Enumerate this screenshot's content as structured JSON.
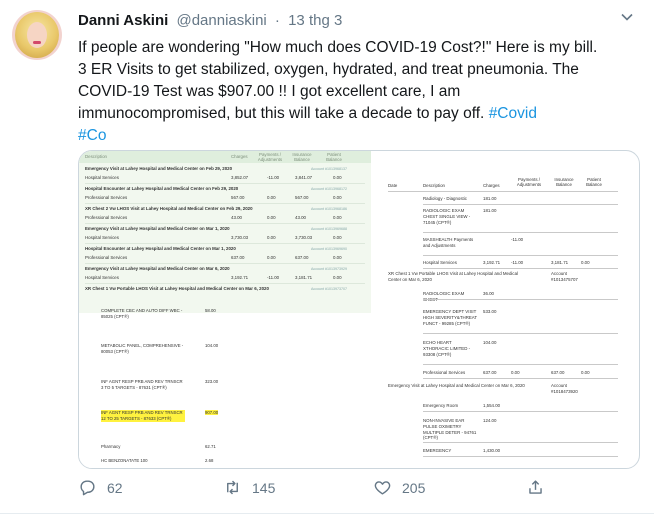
{
  "tweet": {
    "display_name": "Danni Askini",
    "handle": "@danniaskini",
    "separator": "·",
    "date": "13 thg 3",
    "text_lines": [
      "If people are wondering \"How much does COVID-19 Cost?!\" Here is my bill.",
      "3 ER Visits to get stabilized, oxygen, hydrated, and treat pneumonia. The",
      "COVID-19 Test was $907.00 !! I got excellent care, I am",
      "immunocompromised, but this will take a decade to pay off."
    ],
    "hashtag1": "#Covid",
    "hashtag2": "#Co",
    "icons": {
      "menu": "chevron-down-icon",
      "reply": "reply-icon",
      "retweet": "retweet-icon",
      "like": "heart-icon",
      "share": "share-icon"
    },
    "colors": {
      "link": "#1b95e0",
      "meta": "#657786",
      "highlight": "#fff23f"
    }
  },
  "actions": {
    "replies": "62",
    "retweets": "145",
    "likes": "205"
  },
  "left_doc": {
    "headers": {
      "description": "Description",
      "charges": "Charges",
      "payments": "Payments / Adjustments",
      "insurance": "Insurance Balance",
      "patient": "Patient Balance"
    },
    "sections": [
      {
        "title": "Emergency Visit at Lahey Hospital and Medical Center on Feb 29, 2020",
        "account": "Account #1013968137",
        "row": {
          "label": "Hospital Services",
          "charges": "3,852.07",
          "payments": "-11.00",
          "insurance": "3,841.07",
          "patient": "0.00"
        }
      },
      {
        "title": "Hospital Encounter at Lahey Hospital and Medical Center on Feb 29, 2020",
        "account": "Account #1013968172",
        "row": {
          "label": "Professional Services",
          "charges": "567.00",
          "payments": "0.00",
          "insurance": "567.00",
          "patient": "0.00"
        }
      },
      {
        "title": "XR Chest 2 Vw LHOS Visit at Lahey Hospital and Medical Center on Feb 29, 2020",
        "account": "Account #1013968186",
        "row": {
          "label": "Professional Services",
          "charges": "43.00",
          "payments": "0.00",
          "insurance": "43.00",
          "patient": "0.00"
        }
      },
      {
        "title": "Emergency Visit at Lahey Hospital and Medical Center on Mar 1, 2020",
        "account": "Account #1013969688",
        "row": {
          "label": "Hospital Services",
          "charges": "3,730.03",
          "payments": "0.00",
          "insurance": "3,730.03",
          "patient": "0.00"
        }
      },
      {
        "title": "Hospital Encounter at Lahey Hospital and Medical Center on Mar 1, 2020",
        "account": "Account #1013969690",
        "row": {
          "label": "Professional Services",
          "charges": "637.00",
          "payments": "0.00",
          "insurance": "637.00",
          "patient": "0.00"
        }
      },
      {
        "title": "Emergency Visit at Lahey Hospital and Medical Center on Mar 6, 2020",
        "account": "Account #1013973929",
        "row": {
          "label": "Hospital Services",
          "charges": "3,192.71",
          "payments": "-11.00",
          "insurance": "3,181.71",
          "patient": "0.00"
        }
      },
      {
        "title": "XR Chest 1 Vw Portable LHOS Visit at Lahey Hospital and Medical Center on Mar 6, 2020",
        "account": "Account #1013973707",
        "row": null
      }
    ],
    "items": [
      {
        "label": "COMPLETE CBC AND AUTO DIFF WBC - 85025 (CPT®)",
        "amount": "58.00"
      },
      {
        "label": "METABOLIC PANEL, COMPREHENSIVE - 80053 (CPT®)",
        "amount": "104.00"
      },
      {
        "label": "INF AGNT RESP PRB AND REV TRNSCR 3 TO 5 TARGETS - 87631 (CPT®)",
        "amount": "323.00"
      },
      {
        "label": "INF AGNT RESP PRB AND REV TRNSCR 12 TO 25 TARGETS - 87633 (CPT®)",
        "amount": "907.00"
      },
      {
        "label": "Pharmacy",
        "amount": "62.71"
      },
      {
        "label": "HC BENZONATATE 100",
        "amount": "2.68"
      }
    ]
  },
  "right_doc": {
    "headers": {
      "date": "Date",
      "description": "Description",
      "charges": "Charges",
      "payments": "Payments / Adjustments",
      "insurance": "Insurance Balance",
      "patient": "Patient Balance"
    },
    "rows": [
      {
        "desc": "Radiology - Diagnostic",
        "charges": "181.00"
      },
      {
        "desc": "RADIOLOGIC EXAM CHEST SINGLE VIEW - 71045 (CPT®)",
        "charges": "181.00"
      },
      {
        "desc": "MASSHEALTH Payments and Adjustments",
        "payments": "-11.00"
      },
      {
        "desc": "Hospital Services",
        "charges": "3,192.71",
        "payments": "-11.00",
        "insurance": "3,181.71",
        "patient": "0.00"
      }
    ],
    "section1": {
      "title": "XR Chest 1 Vw Portable LHOS Visit at Lahey Hospital and Medical Center on Mar 6, 2020",
      "account_label": "Account",
      "account": "#1013475707"
    },
    "rows2": [
      {
        "desc": "RADIOLOGIC EXAM CHEST",
        "charges": "36.00"
      },
      {
        "desc": "EMERGENCY DEPT VISIT HIGH SEVERITY&THREAT FUNCT - 99285 (CPT®)",
        "charges": "533.00"
      },
      {
        "desc": "ECHO HEART XTHORACIC LIMITED - 93308 (CPT®)",
        "charges": "104.00"
      },
      {
        "desc": "Professional Services",
        "charges": "637.00",
        "payments": "0.00",
        "insurance": "637.00",
        "patient": "0.00"
      }
    ],
    "section2": {
      "title": "Emergency Visit at Lahey Hospital and Medical Center on Mar 6, 2020",
      "account_label": "Account",
      "account": "#1018473920"
    },
    "rows3": [
      {
        "desc": "Emergency Room",
        "charges": "1,554.00"
      },
      {
        "desc": "NON-INVASIVE EAR PULSE OXIMETRY MULTIPLE DETER - 94761 (CPT®)",
        "charges": "124.00"
      },
      {
        "desc": "EMERGENCY",
        "charges": "1,430.00"
      }
    ]
  }
}
